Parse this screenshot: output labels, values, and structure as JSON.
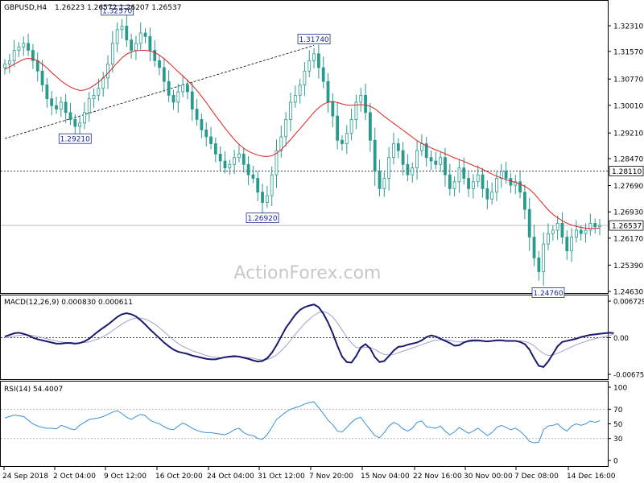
{
  "header": {
    "symbol": "GBPUSD,H4",
    "ohlc": "1.26223 1.26572 1.26207 1.26537"
  },
  "watermark": "ActionForex.com",
  "colors": {
    "candle": "#2a9a8e",
    "ma": "#e02020",
    "macd": "#1a1a6e",
    "signal": "#a0a0d0",
    "rsi": "#3a90d8",
    "box_border": "#1a2a8a"
  },
  "chart_data": [
    {
      "type": "candlestick",
      "panel": "price",
      "ylim": [
        1.2463,
        1.2345
      ],
      "yticks": [
        "1.32310",
        "1.31570",
        "1.30770",
        "1.30010",
        "1.29210",
        "1.28470",
        "1.27690",
        "1.26930",
        "1.26170",
        "1.25390",
        "1.24630"
      ],
      "ytick_values": [
        1.3231,
        1.3157,
        1.3077,
        1.3001,
        1.2921,
        1.2847,
        1.2769,
        1.2693,
        1.2617,
        1.2539,
        1.2463
      ],
      "xticks": [
        "24 Sep 2018",
        "2 Oct 04:00",
        "9 Oct 12:00",
        "16 Oct 20:00",
        "24 Oct 04:00",
        "31 Oct 12:00",
        "7 Nov 20:00",
        "15 Nov 04:00",
        "22 Nov 16:00",
        "30 Nov 00:00",
        "7 Dec 08:00",
        "14 Dec 16:00"
      ],
      "current_price": {
        "value": 1.26537,
        "label": "1.26537"
      },
      "reference_line": {
        "value": 1.2811,
        "label": "1.28110"
      },
      "annotations": [
        {
          "label": "1.32570",
          "value": 1.3257,
          "bar": 24
        },
        {
          "label": "1.31740",
          "value": 1.3174,
          "bar": 66
        },
        {
          "label": "1.29210",
          "value": 1.2921,
          "bar": 15
        },
        {
          "label": "1.26920",
          "value": 1.2692,
          "bar": 55
        },
        {
          "label": "1.24760",
          "value": 1.2476,
          "bar": 116
        }
      ],
      "trendline": [
        [
          0,
          1.2905
        ],
        [
          66,
          1.3174
        ]
      ],
      "close": [
        1.312,
        1.313,
        1.316,
        1.317,
        1.318,
        1.316,
        1.313,
        1.31,
        1.306,
        1.302,
        1.3,
        1.299,
        1.301,
        1.298,
        1.296,
        1.294,
        1.295,
        1.298,
        1.302,
        1.303,
        1.305,
        1.308,
        1.312,
        1.318,
        1.322,
        1.323,
        1.319,
        1.316,
        1.318,
        1.321,
        1.32,
        1.316,
        1.313,
        1.311,
        1.307,
        1.303,
        1.301,
        1.304,
        1.306,
        1.304,
        1.299,
        1.296,
        1.293,
        1.291,
        1.289,
        1.286,
        1.284,
        1.282,
        1.283,
        1.285,
        1.286,
        1.283,
        1.28,
        1.279,
        1.275,
        1.272,
        1.274,
        1.28,
        1.287,
        1.291,
        1.296,
        1.301,
        1.303,
        1.306,
        1.31,
        1.313,
        1.315,
        1.311,
        1.307,
        1.301,
        1.297,
        1.29,
        1.289,
        1.292,
        1.296,
        1.301,
        1.303,
        1.298,
        1.29,
        1.281,
        1.276,
        1.279,
        1.285,
        1.289,
        1.287,
        1.283,
        1.28,
        1.282,
        1.287,
        1.289,
        1.285,
        1.284,
        1.283,
        1.285,
        1.28,
        1.276,
        1.278,
        1.282,
        1.279,
        1.276,
        1.278,
        1.28,
        1.276,
        1.273,
        1.275,
        1.279,
        1.281,
        1.279,
        1.277,
        1.278,
        1.275,
        1.27,
        1.262,
        1.256,
        1.252,
        1.26,
        1.263,
        1.264,
        1.266,
        1.262,
        1.258,
        1.262,
        1.264,
        1.263,
        1.264,
        1.266,
        1.265,
        1.2654
      ],
      "ma": [
        1.3105,
        1.3112,
        1.312,
        1.3127,
        1.3134,
        1.3137,
        1.3135,
        1.313,
        1.312,
        1.3109,
        1.3096,
        1.3084,
        1.3072,
        1.3062,
        1.3054,
        1.3048,
        1.3044,
        1.3045,
        1.305,
        1.3058,
        1.3068,
        1.308,
        1.3094,
        1.3109,
        1.3124,
        1.3138,
        1.3149,
        1.3155,
        1.3159,
        1.316,
        1.316,
        1.3158,
        1.3154,
        1.3146,
        1.3136,
        1.3124,
        1.3111,
        1.3098,
        1.3086,
        1.3073,
        1.3059,
        1.3044,
        1.3027,
        1.3009,
        1.299,
        1.2971,
        1.2953,
        1.2935,
        1.2918,
        1.2902,
        1.2888,
        1.2877,
        1.2868,
        1.2862,
        1.2857,
        1.2854,
        1.2853,
        1.2855,
        1.2862,
        1.2873,
        1.2887,
        1.2902,
        1.2918,
        1.2933,
        1.2949,
        1.2965,
        1.2981,
        1.2994,
        1.3004,
        1.301,
        1.3012,
        1.3009,
        1.3005,
        1.3002,
        1.3001,
        1.3002,
        1.3003,
        1.3002,
        1.2998,
        1.2991,
        1.298,
        1.2969,
        1.2959,
        1.2949,
        1.2939,
        1.2929,
        1.2919,
        1.2909,
        1.2899,
        1.2891,
        1.2884,
        1.2878,
        1.2872,
        1.2867,
        1.2861,
        1.2855,
        1.2849,
        1.2844,
        1.2839,
        1.2833,
        1.2827,
        1.2822,
        1.2816,
        1.2809,
        1.2802,
        1.2796,
        1.2791,
        1.2786,
        1.2782,
        1.2778,
        1.2773,
        1.2767,
        1.2758,
        1.2746,
        1.273,
        1.2714,
        1.2699,
        1.2686,
        1.2676,
        1.2667,
        1.266,
        1.2655,
        1.2651,
        1.2648,
        1.2646,
        1.2645,
        1.2645,
        1.2646
      ]
    },
    {
      "type": "line",
      "panel": "macd",
      "title": "MACD(12,26,9) 0.000830 0.000611",
      "ylim": [
        -0.00675,
        0.00673
      ],
      "yticks": [
        "0.006729",
        "0.00",
        "-0.006758"
      ],
      "ytick_values": [
        0.006729,
        0.0,
        -0.006758
      ],
      "series": [
        {
          "values": [
            0.0002,
            0.0005,
            0.0008,
            0.0009,
            0.0007,
            0.0004,
            0.0,
            -0.0003,
            -0.0005,
            -0.0007,
            -0.0009,
            -0.0011,
            -0.0011,
            -0.001,
            -0.001,
            -0.0011,
            -0.001,
            -0.0007,
            -0.0002,
            0.0005,
            0.0012,
            0.0018,
            0.0024,
            0.0031,
            0.0038,
            0.0043,
            0.0045,
            0.0043,
            0.0039,
            0.0032,
            0.0024,
            0.0015,
            0.0007,
            -0.0001,
            -0.0009,
            -0.0016,
            -0.0022,
            -0.0026,
            -0.0028,
            -0.003,
            -0.0033,
            -0.0035,
            -0.0037,
            -0.0039,
            -0.004,
            -0.004,
            -0.0038,
            -0.0036,
            -0.0035,
            -0.0034,
            -0.0035,
            -0.0037,
            -0.0039,
            -0.0042,
            -0.0044,
            -0.0043,
            -0.0038,
            -0.0028,
            -0.0014,
            0.0002,
            0.0018,
            0.003,
            0.0042,
            0.0051,
            0.0056,
            0.0059,
            0.0061,
            0.0056,
            0.0044,
            0.0028,
            0.0008,
            -0.0015,
            -0.0035,
            -0.0045,
            -0.0046,
            -0.0034,
            -0.0018,
            -0.0012,
            -0.002,
            -0.0036,
            -0.0045,
            -0.0043,
            -0.0034,
            -0.0024,
            -0.0017,
            -0.0016,
            -0.0013,
            -0.0011,
            -0.0009,
            -0.0005,
            0.0001,
            0.0004,
            0.0002,
            -0.0002,
            -0.0006,
            -0.001,
            -0.0015,
            -0.0014,
            -0.0009,
            -0.0006,
            -0.0005,
            -0.0005,
            -0.0006,
            -0.0007,
            -0.0006,
            -0.0005,
            -0.0005,
            -0.0006,
            -0.0006,
            -0.0006,
            -0.0008,
            -0.0012,
            -0.0022,
            -0.0038,
            -0.0052,
            -0.0054,
            -0.0044,
            -0.003,
            -0.0016,
            -0.0008,
            -0.0006,
            -0.0004,
            -0.0002,
            0.0001,
            0.0003,
            0.0005,
            0.0006,
            0.0007,
            0.0008,
            0.0009,
            0.00083
          ]
        },
        {
          "values": [
            0.0,
            0.0001,
            0.0003,
            0.0004,
            0.0005,
            0.0005,
            0.0004,
            0.0002,
            0.0,
            -0.0002,
            -0.0004,
            -0.0006,
            -0.0008,
            -0.0009,
            -0.0009,
            -0.001,
            -0.001,
            -0.0009,
            -0.0008,
            -0.0005,
            -0.0002,
            0.0002,
            0.0007,
            0.0013,
            0.0019,
            0.0025,
            0.003,
            0.0034,
            0.0036,
            0.0036,
            0.0034,
            0.003,
            0.0025,
            0.0018,
            0.0011,
            0.0003,
            -0.0004,
            -0.0011,
            -0.0016,
            -0.002,
            -0.0024,
            -0.0027,
            -0.003,
            -0.0033,
            -0.0035,
            -0.0036,
            -0.0037,
            -0.0037,
            -0.0036,
            -0.0036,
            -0.0035,
            -0.0036,
            -0.0037,
            -0.0038,
            -0.004,
            -0.0041,
            -0.004,
            -0.0037,
            -0.0032,
            -0.0024,
            -0.0015,
            -0.0005,
            0.0006,
            0.0016,
            0.0026,
            0.0034,
            0.0041,
            0.0046,
            0.0048,
            0.0045,
            0.0038,
            0.0027,
            0.0014,
            0.0001,
            -0.001,
            -0.0018,
            -0.0019,
            -0.0018,
            -0.0018,
            -0.0022,
            -0.0027,
            -0.0031,
            -0.0032,
            -0.0031,
            -0.0028,
            -0.0025,
            -0.0022,
            -0.0019,
            -0.0016,
            -0.0013,
            -0.001,
            -0.0007,
            -0.0005,
            -0.0004,
            -0.0004,
            -0.0005,
            -0.0007,
            -0.0008,
            -0.0008,
            -0.0008,
            -0.0007,
            -0.0007,
            -0.0006,
            -0.0006,
            -0.0006,
            -0.0006,
            -0.0006,
            -0.0006,
            -0.0006,
            -0.0006,
            -0.0006,
            -0.0007,
            -0.001,
            -0.0015,
            -0.0023,
            -0.0029,
            -0.0033,
            -0.0032,
            -0.0029,
            -0.0025,
            -0.0021,
            -0.0017,
            -0.0013,
            -0.001,
            -0.0007,
            -0.0004,
            -0.0002,
            0.0,
            0.0002,
            0.0004,
            0.00061
          ]
        }
      ]
    },
    {
      "type": "line",
      "panel": "rsi",
      "title": "RSI(14) 54.4007",
      "ylim": [
        0,
        100
      ],
      "yticks": [
        "100",
        "70",
        "50",
        "30",
        "0"
      ],
      "ytick_values": [
        100,
        70,
        50,
        30,
        0
      ],
      "levels": [
        70,
        30
      ],
      "series": [
        {
          "values": [
            58,
            60,
            62,
            61,
            60,
            55,
            50,
            47,
            45,
            44,
            44,
            43,
            48,
            46,
            43,
            42,
            48,
            52,
            56,
            57,
            58,
            60,
            63,
            66,
            68,
            64,
            59,
            56,
            60,
            63,
            61,
            55,
            52,
            50,
            46,
            43,
            42,
            47,
            51,
            48,
            44,
            41,
            39,
            38,
            38,
            37,
            36,
            35,
            38,
            42,
            44,
            38,
            35,
            34,
            30,
            29,
            35,
            45,
            56,
            61,
            66,
            70,
            72,
            74,
            77,
            79,
            80,
            72,
            64,
            55,
            49,
            40,
            39,
            45,
            52,
            57,
            59,
            50,
            42,
            34,
            31,
            38,
            47,
            52,
            49,
            43,
            40,
            44,
            52,
            54,
            46,
            45,
            44,
            47,
            40,
            35,
            39,
            45,
            41,
            37,
            40,
            44,
            39,
            34,
            38,
            45,
            48,
            45,
            42,
            44,
            40,
            34,
            26,
            24,
            25,
            42,
            47,
            48,
            50,
            44,
            40,
            47,
            50,
            48,
            50,
            54,
            52,
            54.4
          ]
        }
      ]
    }
  ]
}
